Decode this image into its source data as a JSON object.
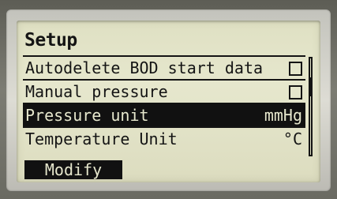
{
  "screen": {
    "title": "Setup"
  },
  "menu": {
    "items": [
      {
        "label": "Autodelete BOD start data",
        "control": "checkbox",
        "checked": false
      },
      {
        "label": "Manual pressure",
        "control": "checkbox",
        "checked": false
      },
      {
        "label": "Pressure unit",
        "value": "mmHg",
        "selected": true
      },
      {
        "label": "Temperature Unit",
        "value": "°C"
      }
    ]
  },
  "softkeys": {
    "left_label": "Modify"
  },
  "colors": {
    "lcd_background": "#e3e4c9",
    "lcd_ink": "#141414",
    "bezel": "#d2d1ca"
  }
}
